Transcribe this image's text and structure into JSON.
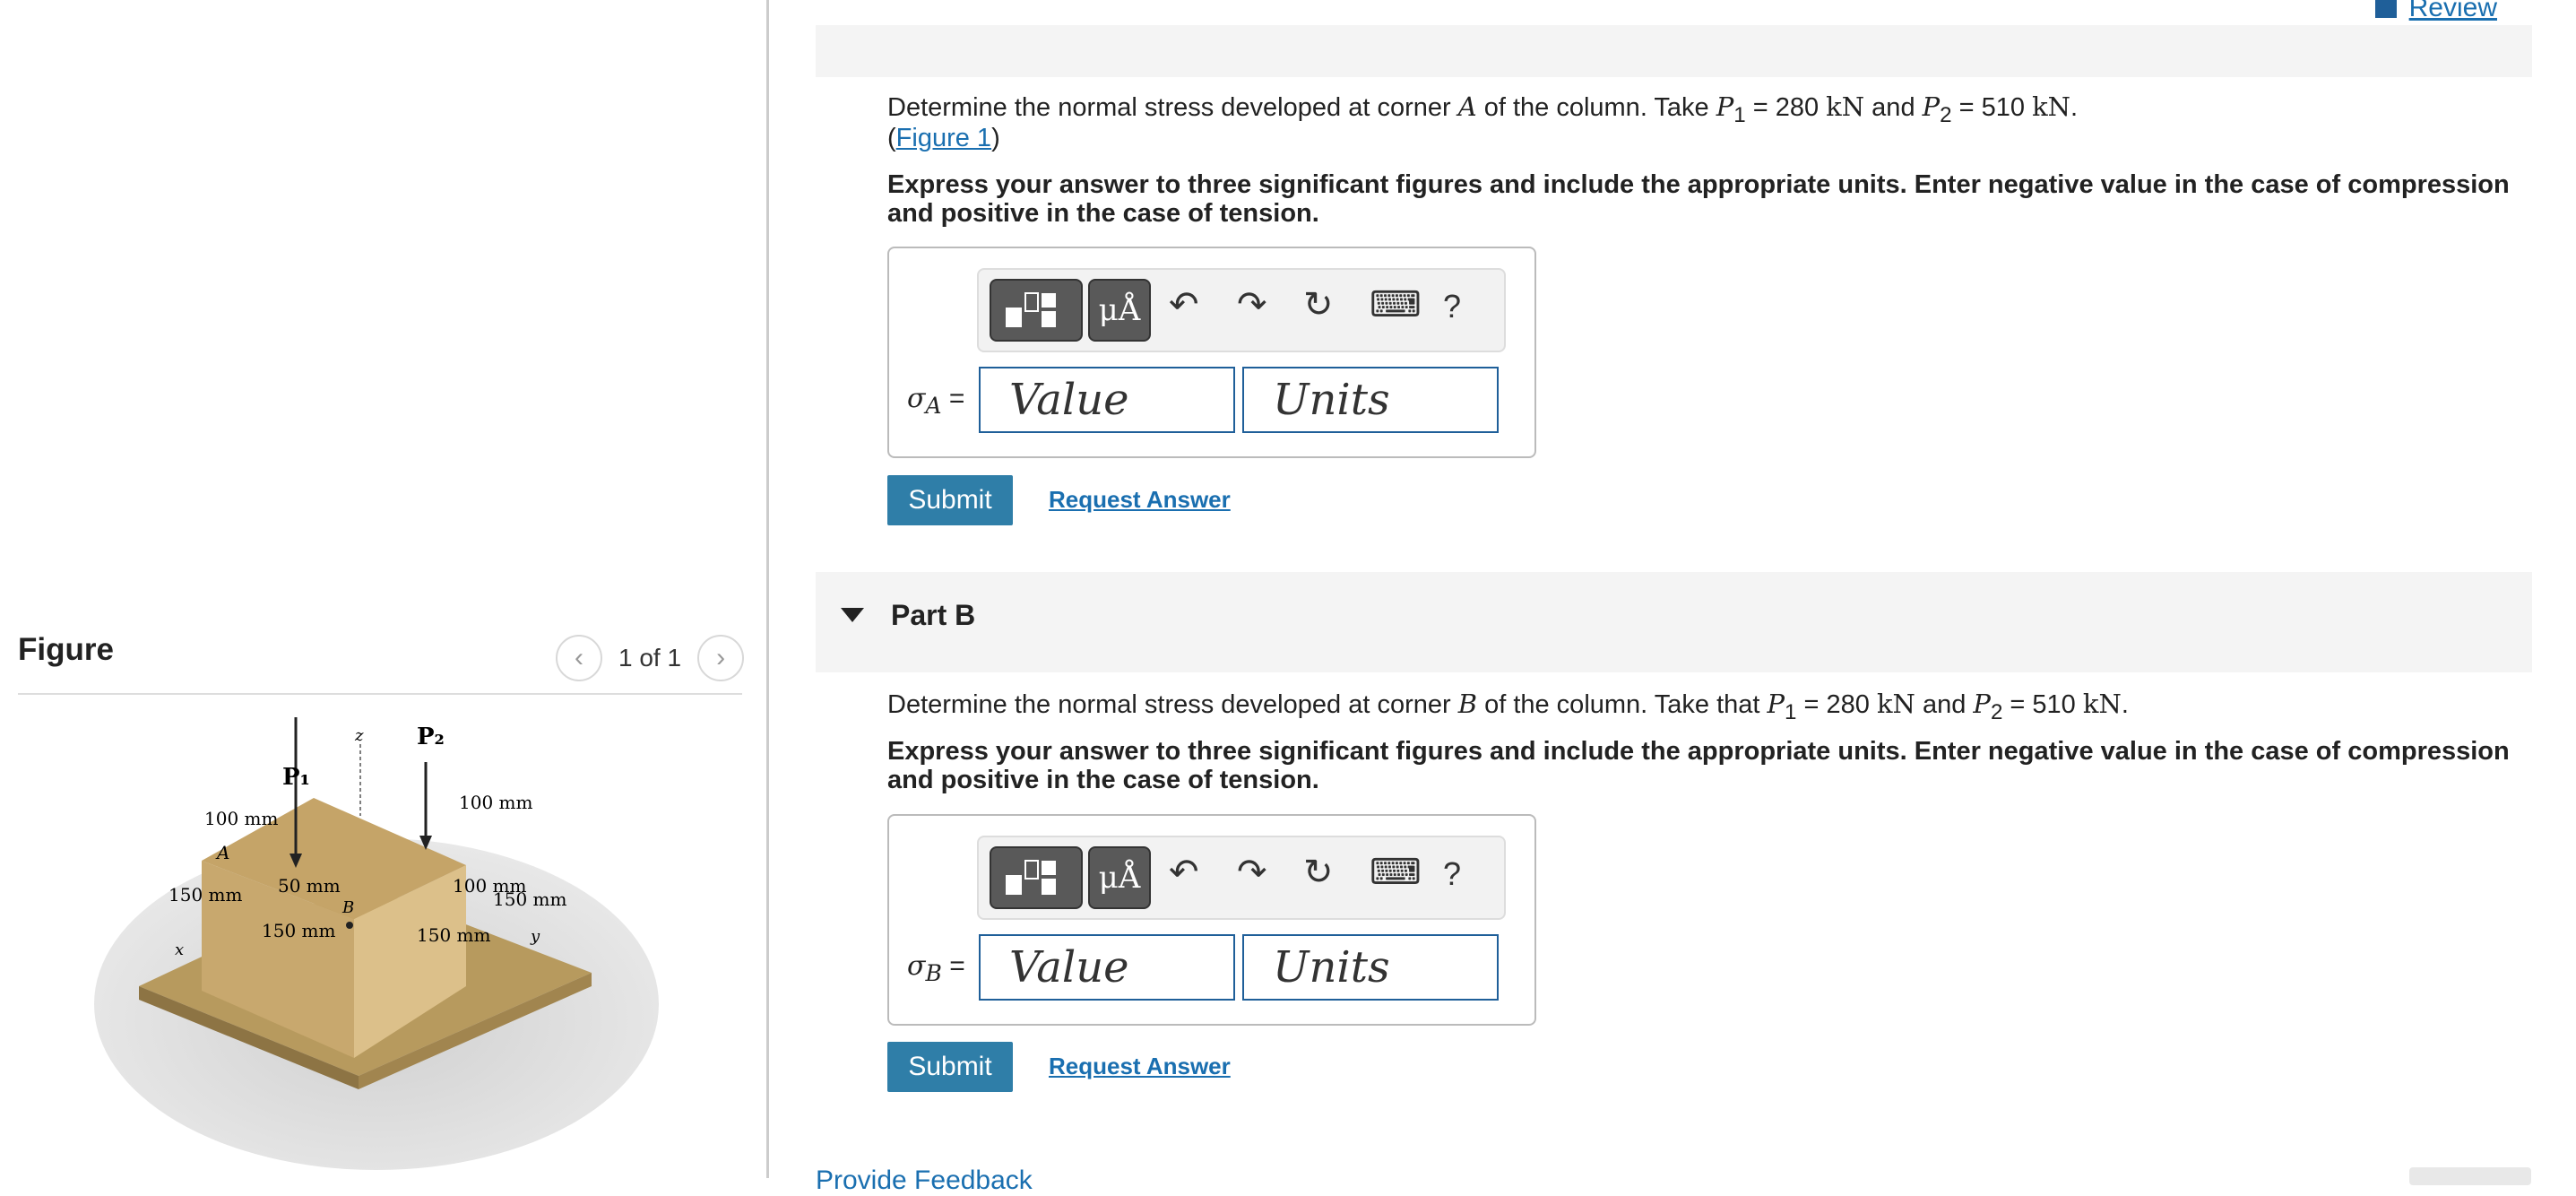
{
  "review": {
    "label": "Review"
  },
  "partA": {
    "question": {
      "pre": "Determine the normal stress developed at corner ",
      "corner": "A",
      "mid": " of the column. Take ",
      "p1_label": "P",
      "p1_sub": "1",
      "p1_val": " = 280 ",
      "unit1": "kN",
      "and": " and ",
      "p2_label": "P",
      "p2_sub": "2",
      "p2_val": " = 510 ",
      "unit2": "kN",
      "end": "."
    },
    "figure_link": {
      "open": "(",
      "label": "Figure 1",
      "close": ")"
    },
    "instruction": "Express your answer to three significant figures and include the appropriate units. Enter negative value in the case of compression and positive in the case of tension.",
    "sigma_label": "σ",
    "sigma_sub": "A",
    "equals": " =",
    "value_placeholder": "Value",
    "units_placeholder": "Units",
    "submit": "Submit",
    "request": "Request Answer"
  },
  "partB": {
    "title": "Part B",
    "question": {
      "pre": "Determine the normal stress developed at corner ",
      "corner": "B",
      "mid": " of the column. Take that ",
      "p1_label": "P",
      "p1_sub": "1",
      "p1_val": " = 280 ",
      "unit1": "kN",
      "and": " and ",
      "p2_label": "P",
      "p2_sub": "2",
      "p2_val": " = 510 ",
      "unit2": "kN",
      "end": "."
    },
    "instruction": "Express your answer to three significant figures and include the appropriate units. Enter negative value in the case of compression and positive in the case of tension.",
    "sigma_label": "σ",
    "sigma_sub": "B",
    "equals": " =",
    "value_placeholder": "Value",
    "units_placeholder": "Units",
    "submit": "Submit",
    "request": "Request Answer"
  },
  "toolbar": {
    "mu_label": "μÅ",
    "undo": "↶",
    "redo": "↷",
    "reset": "↻",
    "keyboard": "⌨",
    "help": "?"
  },
  "figure": {
    "heading": "Figure",
    "pager": "1 of 1",
    "labels": {
      "p1": "P₁",
      "p2": "P₂",
      "z": "z",
      "x": "x",
      "y": "y",
      "a": "A",
      "b": "B",
      "d100a": "100 mm",
      "d100b": "100 mm",
      "d150a": "150 mm",
      "d50": "50 mm",
      "d100c": "100 mm",
      "d150b": "150 mm",
      "d150c": "150 mm",
      "d150d": "150 mm"
    }
  },
  "feedback": {
    "label": "Provide Feedback"
  }
}
